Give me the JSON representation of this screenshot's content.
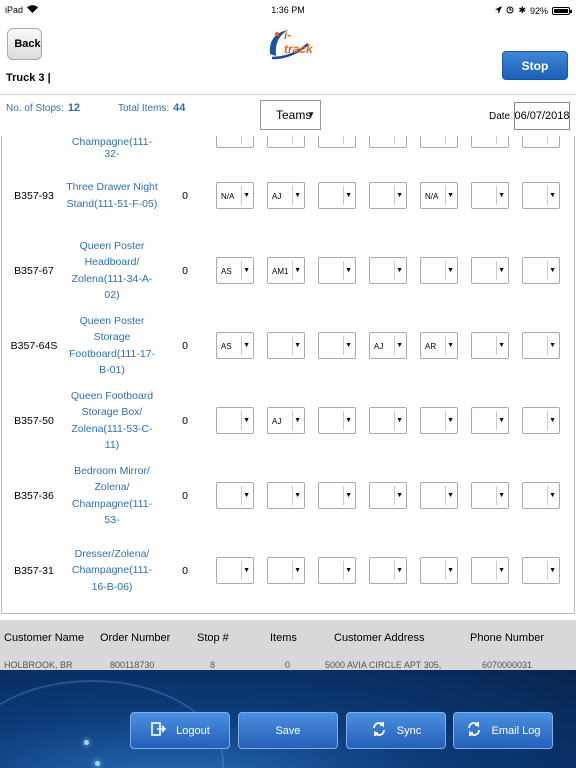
{
  "status_bar": {
    "device": "iPad",
    "time": "1:36 PM",
    "battery": "92%"
  },
  "header": {
    "back_label": "Back",
    "logo_text": "i-track",
    "truck_title": "Truck 3 |",
    "stop_label": "Stop"
  },
  "info": {
    "stops_label": "No. of Stops:",
    "stops_value": "12",
    "items_label": "Total Items:",
    "items_value": "44",
    "teams_label": "Teams",
    "date_label": "Date :",
    "date_value": "06/07/2018"
  },
  "partial_top_text": "Champagne(111-32-",
  "rows": [
    {
      "code": "B357-93",
      "name": "Three Drawer Night Stand(111-51-F-05)",
      "qty": "0",
      "dropdowns": [
        "N/A",
        "AJ",
        "",
        "",
        "N/A",
        "",
        ""
      ]
    },
    {
      "code": "B357-67",
      "name": "Queen Poster Headboard/ Zolena(111-34-A-02)",
      "qty": "0",
      "dropdowns": [
        "AS",
        "AM1",
        "",
        "",
        "",
        "",
        ""
      ]
    },
    {
      "code": "B357-64S",
      "name": "Queen Poster Storage Footboard(111-17-B-01)",
      "qty": "0",
      "dropdowns": [
        "AS",
        "",
        "",
        "AJ",
        "AR",
        "",
        ""
      ]
    },
    {
      "code": "B357-50",
      "name": "Queen Footboard Storage Box/ Zolena(111-53-C-11)",
      "qty": "0",
      "dropdowns": [
        "",
        "AJ",
        "",
        "",
        "",
        "",
        ""
      ]
    },
    {
      "code": "B357-36",
      "name": "Bedroom Mirror/ Zolena/ Champagne(111-53-",
      "qty": "0",
      "dropdowns": [
        "",
        "",
        "",
        "",
        "",
        "",
        ""
      ]
    },
    {
      "code": "B357-31",
      "name": "Dresser/Zolena/ Champagne(111-16-B-06)",
      "qty": "0",
      "dropdowns": [
        "",
        "",
        "",
        "",
        "",
        "",
        ""
      ]
    }
  ],
  "orders_table": {
    "columns": [
      "Customer Name",
      "Order Number",
      "Stop #",
      "Items",
      "Customer Address",
      "Phone Number"
    ],
    "partial_row": {
      "name": "HOLBROOK, BR",
      "order": "800118730",
      "stop": "8",
      "items": "0",
      "address": "5000 AVIA CIRCLE APT 305,",
      "phone": "6070000031"
    }
  },
  "footer": {
    "logout_label": "Logout",
    "save_label": "Save",
    "sync_label": "Sync",
    "email_label": "Email Log"
  },
  "colors": {
    "link_blue": "#2f6fb3",
    "stop_button": "#2a6fce",
    "footer_bg": "#0c3c7a"
  }
}
